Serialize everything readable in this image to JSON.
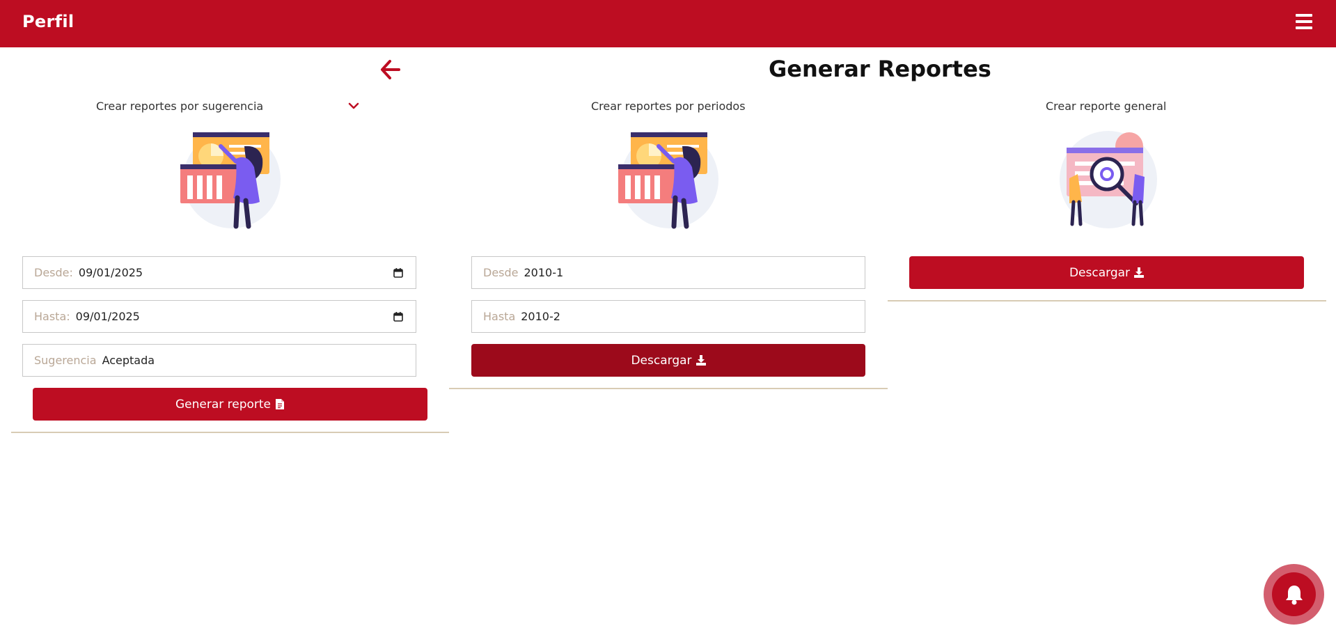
{
  "header": {
    "brand": "Perfil",
    "menu_icon": "hamburger-icon"
  },
  "page": {
    "title": "Generar Reportes",
    "back_icon": "arrow-left-icon"
  },
  "sections": {
    "suggestion": {
      "label": "Crear reportes por sugerencia",
      "desde_label": "Desde:",
      "desde_value": "09/01/2025",
      "hasta_label": "Hasta:",
      "hasta_value": "09/01/2025",
      "sugerencia_label": "Sugerencia",
      "sugerencia_value": "Aceptada",
      "button_label": "Generar reporte"
    },
    "periods": {
      "label": "Crear reportes por periodos",
      "desde_label": "Desde",
      "desde_value": "2010-1",
      "hasta_label": "Hasta",
      "hasta_value": "2010-2",
      "button_label": "Descargar"
    },
    "general": {
      "label": "Crear reporte general",
      "button_label": "Descargar"
    }
  },
  "colors": {
    "primary": "#bd0d22",
    "primary_dark": "#9c0a1b",
    "placeholder": "#b9a796",
    "divider": "#d8cbb4"
  },
  "notification": {
    "icon": "bell-icon"
  }
}
